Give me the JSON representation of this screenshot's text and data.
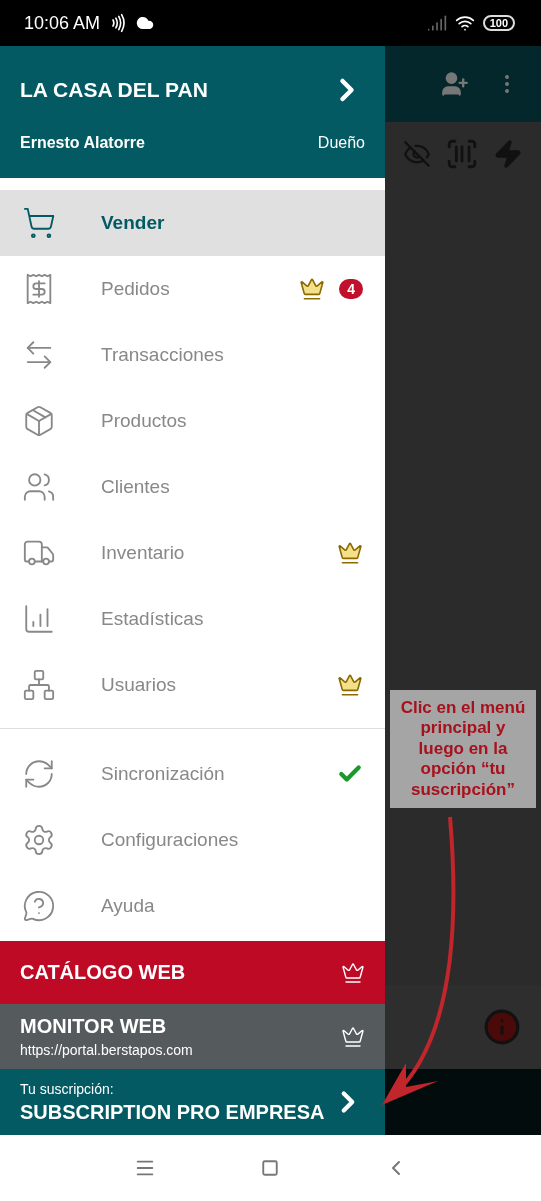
{
  "status_bar": {
    "time": "10:06 AM",
    "battery": "100"
  },
  "header": {
    "business": "LA CASA DEL PAN",
    "user": "Ernesto Alatorre",
    "role": "Dueño"
  },
  "menu": [
    {
      "label": "Vender",
      "selected": true,
      "premium": false
    },
    {
      "label": "Pedidos",
      "selected": false,
      "premium": true,
      "badge": "4"
    },
    {
      "label": "Transacciones",
      "selected": false,
      "premium": false
    },
    {
      "label": "Productos",
      "selected": false,
      "premium": false
    },
    {
      "label": "Clientes",
      "selected": false,
      "premium": false
    },
    {
      "label": "Inventario",
      "selected": false,
      "premium": true
    },
    {
      "label": "Estadísticas",
      "selected": false,
      "premium": false
    },
    {
      "label": "Usuarios",
      "selected": false,
      "premium": true
    }
  ],
  "tools": [
    {
      "label": "Sincronización",
      "selected": false,
      "synced": true
    },
    {
      "label": "Configuraciones",
      "selected": false,
      "synced": false
    },
    {
      "label": "Ayuda",
      "selected": false,
      "synced": false
    }
  ],
  "catalog": {
    "title": "CATÁLOGO WEB",
    "premium": true
  },
  "monitor": {
    "title": "MONITOR WEB",
    "url": "https://portal.berstapos.com",
    "premium": true
  },
  "subscription": {
    "label": "Tu suscripción:",
    "plan": "SUBSCRIPTION PRO EMPRESA"
  },
  "annotation": {
    "text": "Clic en el menú principal y luego en la opción “tu suscripción”"
  }
}
